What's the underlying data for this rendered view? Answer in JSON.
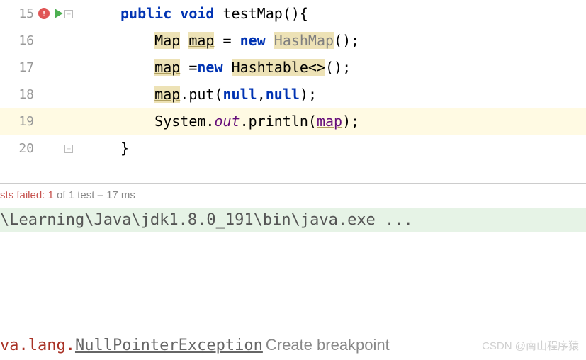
{
  "lines": {
    "15": "15",
    "16": "16",
    "17": "17",
    "18": "18",
    "19": "19",
    "20": "20"
  },
  "code": {
    "l15": {
      "kw_public": "public",
      "kw_void": "void",
      "method": "testMap",
      "parens": "(){"
    },
    "l16": {
      "type": "Map",
      "var": "map",
      "eq": " = ",
      "kw_new": "new",
      "ctor": "HashMap",
      "tail": "();"
    },
    "l17": {
      "var": "map",
      "eq": " =",
      "kw_new": "new",
      "ctor": "Hashtable<>",
      "tail": "();"
    },
    "l18": {
      "var": "map",
      "dot_put": ".put(",
      "null1": "null",
      "comma": ",",
      "null2": "null",
      "tail": ");"
    },
    "l19": {
      "sys": "System.",
      "out": "out",
      "dot_println": ".println(",
      "var": "map",
      "tail": ");"
    },
    "l20": {
      "brace": "}"
    }
  },
  "status": {
    "fail_label": "sts failed: 1",
    "rest": " of 1 test – 17 ms"
  },
  "console": {
    "path": "\\Learning\\Java\\jdk1.8.0_191\\bin\\java.exe ..."
  },
  "exception": {
    "prefix": "va.lang.",
    "name": "NullPointerException",
    "create_bp": "Create breakpoint"
  },
  "watermark": "CSDN @南山程序猿",
  "icons": {
    "error": "!",
    "fold": "−"
  }
}
